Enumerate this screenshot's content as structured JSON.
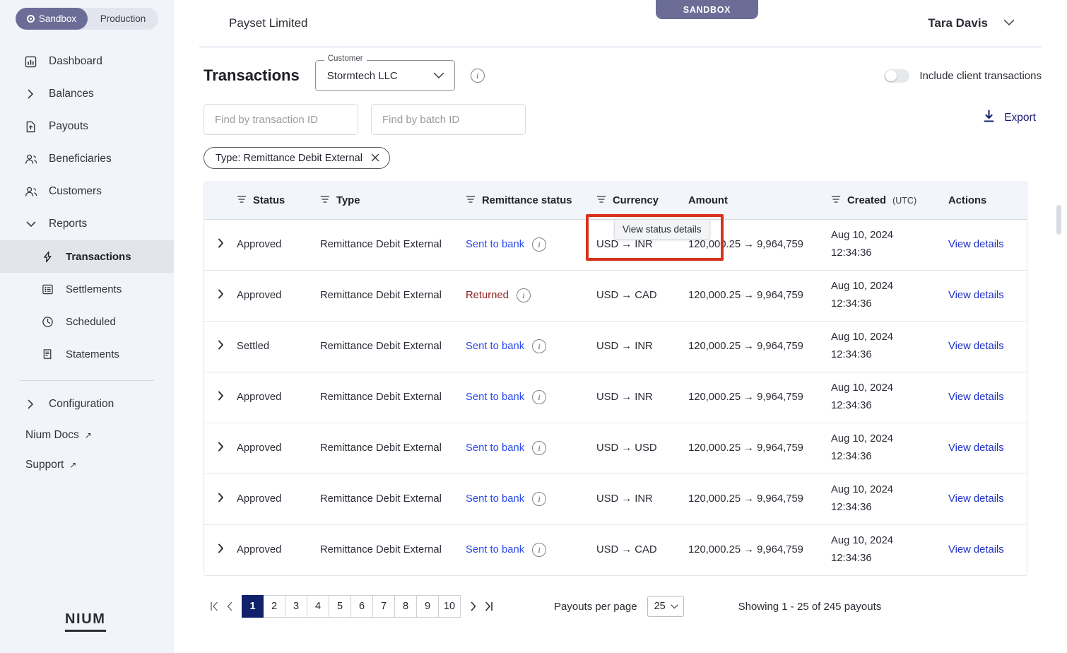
{
  "sidebar": {
    "env_toggle": {
      "sandbox": "Sandbox",
      "production": "Production",
      "active": "Sandbox"
    },
    "items": [
      {
        "label": "Dashboard",
        "icon": "chart-bar-icon",
        "type": "link"
      },
      {
        "label": "Balances",
        "icon": "chevron-right-icon",
        "type": "expandable"
      },
      {
        "label": "Payouts",
        "icon": "document-upload-icon",
        "type": "link"
      },
      {
        "label": "Beneficiaries",
        "icon": "users-icon",
        "type": "link"
      },
      {
        "label": "Customers",
        "icon": "users-icon",
        "type": "link"
      },
      {
        "label": "Reports",
        "icon": "chevron-down-icon",
        "type": "expanded"
      }
    ],
    "report_items": [
      {
        "label": "Transactions",
        "icon": "bolt-icon",
        "active": true
      },
      {
        "label": "Settlements",
        "icon": "list-icon",
        "active": false
      },
      {
        "label": "Scheduled",
        "icon": "clock-icon",
        "active": false
      },
      {
        "label": "Statements",
        "icon": "receipt-icon",
        "active": false
      }
    ],
    "configuration": {
      "label": "Configuration",
      "icon": "chevron-right-icon"
    },
    "external_links": [
      {
        "label": "Nium Docs",
        "icon": "external-link-icon"
      },
      {
        "label": "Support",
        "icon": "external-link-icon"
      }
    ],
    "logo": "NIUM"
  },
  "header": {
    "sandbox_badge": "SANDBOX",
    "org_name": "Payset Limited",
    "user_name": "Tara Davis"
  },
  "page": {
    "title": "Transactions",
    "customer_select": {
      "label": "Customer",
      "value": "Stormtech LLC"
    },
    "info_icon": "info-icon",
    "include_client_transactions": {
      "label": "Include client transactions",
      "enabled": false
    },
    "search_transaction": {
      "placeholder": "Find by transaction ID",
      "value": ""
    },
    "search_batch": {
      "placeholder": "Find by batch ID",
      "value": ""
    },
    "export": {
      "label": "Export",
      "icon": "download-icon"
    },
    "filter_chip": {
      "label": "Type: Remittance Debit External",
      "remove_icon": "close-icon"
    }
  },
  "tooltip": {
    "text": "View status details"
  },
  "table": {
    "columns": [
      {
        "label": "Status",
        "filterable": true
      },
      {
        "label": "Type",
        "filterable": true
      },
      {
        "label": "Remittance status",
        "filterable": true
      },
      {
        "label": "Currency",
        "filterable": true
      },
      {
        "label": "Amount",
        "filterable": false
      },
      {
        "label": "Created",
        "sublabel": "(UTC)",
        "filterable": true
      },
      {
        "label": "Actions",
        "filterable": false
      }
    ],
    "rows": [
      {
        "status": "Approved",
        "type": "Remittance Debit External",
        "remittance_status": "Sent to bank",
        "remittance_state": "link",
        "currency": "USD → INR",
        "amount": "120,000.25 → 9,964,759",
        "created_date": "Aug 10, 2024",
        "created_time": "12:34:36",
        "action": "View details"
      },
      {
        "status": "Approved",
        "type": "Remittance Debit External",
        "remittance_status": "Returned",
        "remittance_state": "returned",
        "currency": "USD → CAD",
        "amount": "120,000.25 → 9,964,759",
        "created_date": "Aug 10, 2024",
        "created_time": "12:34:36",
        "action": "View details"
      },
      {
        "status": "Settled",
        "type": "Remittance Debit External",
        "remittance_status": "Sent to bank",
        "remittance_state": "link",
        "currency": "USD → INR",
        "amount": "120,000.25 → 9,964,759",
        "created_date": "Aug 10, 2024",
        "created_time": "12:34:36",
        "action": "View details"
      },
      {
        "status": "Approved",
        "type": "Remittance Debit External",
        "remittance_status": "Sent to bank",
        "remittance_state": "link",
        "currency": "USD → INR",
        "amount": "120,000.25 → 9,964,759",
        "created_date": "Aug 10, 2024",
        "created_time": "12:34:36",
        "action": "View details"
      },
      {
        "status": "Approved",
        "type": "Remittance Debit External",
        "remittance_status": "Sent to bank",
        "remittance_state": "link",
        "currency": "USD → USD",
        "amount": "120,000.25 → 9,964,759",
        "created_date": "Aug 10, 2024",
        "created_time": "12:34:36",
        "action": "View details"
      },
      {
        "status": "Approved",
        "type": "Remittance Debit External",
        "remittance_status": "Sent to bank",
        "remittance_state": "link",
        "currency": "USD → INR",
        "amount": "120,000.25 → 9,964,759",
        "created_date": "Aug 10, 2024",
        "created_time": "12:34:36",
        "action": "View details"
      },
      {
        "status": "Approved",
        "type": "Remittance Debit External",
        "remittance_status": "Sent to bank",
        "remittance_state": "link",
        "currency": "USD → CAD",
        "amount": "120,000.25 → 9,964,759",
        "created_date": "Aug 10, 2024",
        "created_time": "12:34:36",
        "action": "View details"
      }
    ]
  },
  "pagination": {
    "pages": [
      "1",
      "2",
      "3",
      "4",
      "5",
      "6",
      "7",
      "8",
      "9",
      "10"
    ],
    "current_page": "1",
    "first_icon": "first-page-icon",
    "prev_icon": "prev-page-icon",
    "next_icon": "next-page-icon",
    "last_icon": "last-page-icon",
    "per_page_label": "Payouts per page",
    "per_page_value": "25",
    "showing": "Showing 1 - 25 of 245 payouts"
  },
  "colors": {
    "accent_purple": "#6b6d97",
    "link_blue": "#2b4af0",
    "action_blue": "#1e30c8",
    "returned_red": "#8e2020",
    "highlight_red": "#d6321c",
    "pagination_active": "#10206b",
    "sidebar_bg": "#f1f4f9"
  }
}
